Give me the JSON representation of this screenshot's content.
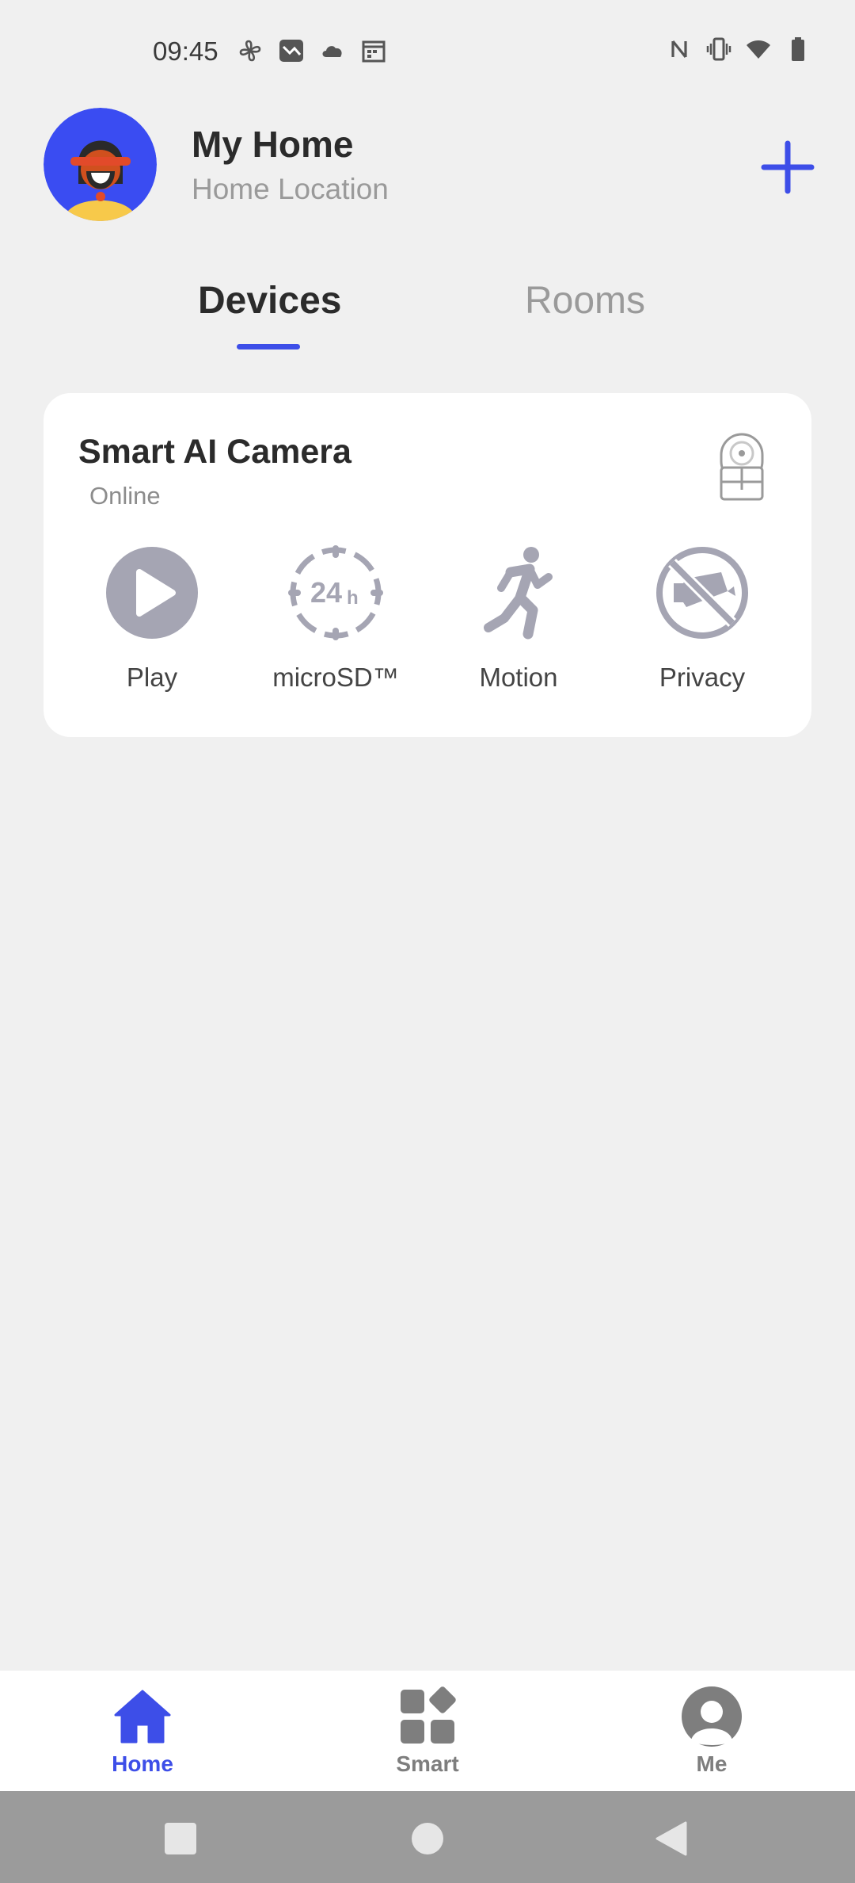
{
  "status_bar": {
    "time": "09:45",
    "left_icons": [
      "fan-icon",
      "photo-icon",
      "cloud-icon",
      "calendar-icon"
    ],
    "right_icons": [
      "nfc-icon",
      "vibrate-icon",
      "wifi-icon",
      "battery-icon"
    ]
  },
  "header": {
    "title": "My Home",
    "subtitle": "Home Location",
    "add_icon": "plus-icon",
    "accent_color": "#3d4ee8"
  },
  "tabs": [
    {
      "label": "Devices",
      "active": true
    },
    {
      "label": "Rooms",
      "active": false
    }
  ],
  "device": {
    "name": "Smart AI Camera",
    "status": "Online",
    "actions": [
      {
        "label": "Play",
        "icon": "play-icon"
      },
      {
        "label": "microSD™",
        "icon": "recording-24h-icon"
      },
      {
        "label": "Motion",
        "icon": "motion-runner-icon"
      },
      {
        "label": "Privacy",
        "icon": "privacy-camera-off-icon"
      }
    ]
  },
  "bottom_nav": [
    {
      "label": "Home",
      "icon": "home-icon",
      "active": true
    },
    {
      "label": "Smart",
      "icon": "smart-grid-icon",
      "active": false
    },
    {
      "label": "Me",
      "icon": "profile-icon",
      "active": false
    }
  ],
  "system_nav": [
    "recents-square-icon",
    "home-circle-icon",
    "back-triangle-icon"
  ]
}
